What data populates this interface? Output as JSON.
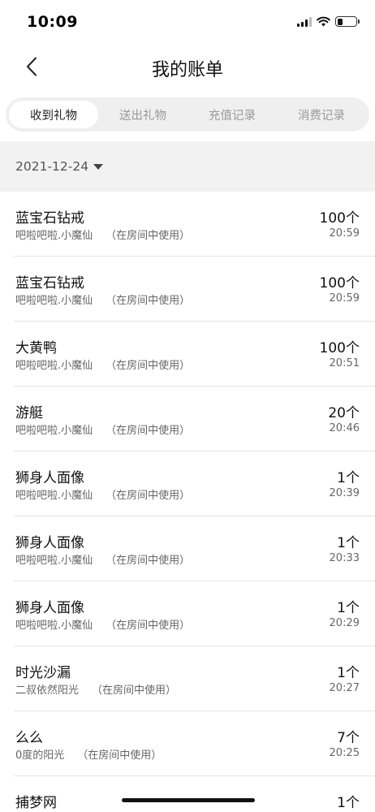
{
  "status_bar": {
    "time": "10:09",
    "battery_level": 0.3
  },
  "header": {
    "title": "我的账单"
  },
  "tabs": [
    {
      "label": "收到礼物",
      "active": true
    },
    {
      "label": "送出礼物",
      "active": false
    },
    {
      "label": "充值记录",
      "active": false
    },
    {
      "label": "消费记录",
      "active": false
    }
  ],
  "date_filter": {
    "value": "2021-12-24"
  },
  "records": [
    {
      "name": "蓝宝石钻戒",
      "from": "吧啦吧啦.小魔仙",
      "note": "（在房间中使用）",
      "qty": "100个",
      "time": "20:59"
    },
    {
      "name": "蓝宝石钻戒",
      "from": "吧啦吧啦.小魔仙",
      "note": "（在房间中使用）",
      "qty": "100个",
      "time": "20:59"
    },
    {
      "name": "大黄鸭",
      "from": "吧啦吧啦.小魔仙",
      "note": "（在房间中使用）",
      "qty": "100个",
      "time": "20:51"
    },
    {
      "name": "游艇",
      "from": "吧啦吧啦.小魔仙",
      "note": "（在房间中使用）",
      "qty": "20个",
      "time": "20:46"
    },
    {
      "name": "狮身人面像",
      "from": "吧啦吧啦.小魔仙",
      "note": "（在房间中使用）",
      "qty": "1个",
      "time": "20:39"
    },
    {
      "name": "狮身人面像",
      "from": "吧啦吧啦.小魔仙",
      "note": "（在房间中使用）",
      "qty": "1个",
      "time": "20:33"
    },
    {
      "name": "狮身人面像",
      "from": "吧啦吧啦.小魔仙",
      "note": "（在房间中使用）",
      "qty": "1个",
      "time": "20:29"
    },
    {
      "name": "时光沙漏",
      "from": "二叔依然阳光",
      "note": "（在房间中使用）",
      "qty": "1个",
      "time": "20:27"
    },
    {
      "name": "么么",
      "from": "0度的阳光",
      "note": "（在房间中使用）",
      "qty": "7个",
      "time": "20:25"
    },
    {
      "name": "捕梦网",
      "from": "",
      "note": "",
      "qty": "1个",
      "time": ""
    }
  ]
}
